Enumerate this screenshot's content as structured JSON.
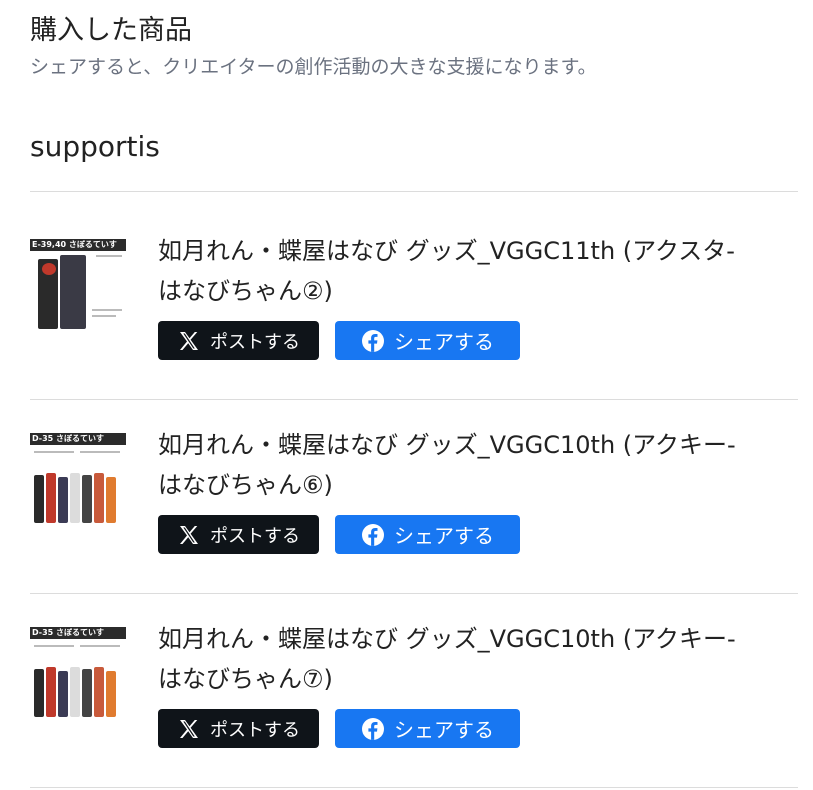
{
  "header": {
    "title": "購入した商品",
    "subtitle": "シェアすると、クリエイターの創作活動の大きな支援になります。"
  },
  "shop": {
    "name": "supportis"
  },
  "buttons": {
    "post_label": "ポストする",
    "share_label": "シェアする",
    "post_icon": "x-logo-icon",
    "share_icon": "facebook-icon"
  },
  "colors": {
    "post_button": "#0f1419",
    "share_button": "#1877f2"
  },
  "items": [
    {
      "line1": "如月れん・蝶屋はなび グッズ_VGGC11th (アクスタ-",
      "line2": "はなびちゃん②)",
      "thumb_banner": "E-39,40 さぼるていす"
    },
    {
      "line1": "如月れん・蝶屋はなび グッズ_VGGC10th (アクキー-",
      "line2": "はなびちゃん⑥)",
      "thumb_banner": "D-35 さぼるていす"
    },
    {
      "line1": "如月れん・蝶屋はなび グッズ_VGGC10th (アクキー-",
      "line2": "はなびちゃん⑦)",
      "thumb_banner": "D-35 さぼるていす"
    }
  ]
}
